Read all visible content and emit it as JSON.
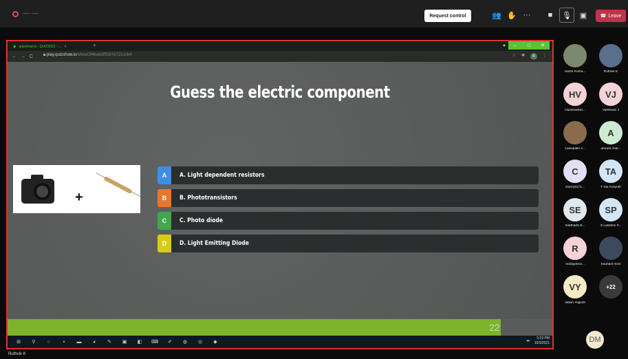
{
  "colors": {
    "answer_a": "#3d8fe6",
    "answer_b": "#e8772e",
    "answer_c": "#3ea84b",
    "answer_d": "#d9cc16",
    "leave": "#c4314b",
    "share_border": "#e0312e",
    "progress": "#7db32a"
  },
  "topbar": {
    "request_control": "Request control",
    "leave_label": "Leave",
    "more_label": "···"
  },
  "browser": {
    "tab_title": "quizshow.io - QUIZ0021 - ...",
    "url_domain": "play.quizshow.io",
    "url_path": "/show/2f4bab3f5587e7231cb4",
    "profile_initial": "R"
  },
  "quiz": {
    "question": "Guess the electric component",
    "answers": [
      {
        "letter": "A",
        "text": "A. Light dependent resistors"
      },
      {
        "letter": "B",
        "text": "B. Phototransistors"
      },
      {
        "letter": "C",
        "text": "C. Photo diode"
      },
      {
        "letter": "D",
        "text": "D. Light Emitting Diode"
      }
    ],
    "image_plus": "+",
    "progress_fraction": 0.905,
    "progress_count": "22"
  },
  "taskbar": {
    "time": "5:03 PM",
    "date": "10/3/2021"
  },
  "presenter_name": "Ruthvik K",
  "participants": [
    {
      "name": "Harsh Kuma...",
      "initials": "",
      "bg": "#7b8a6e",
      "photo": true
    },
    {
      "name": "Ruthvik K",
      "initials": "",
      "bg": "#5a6f8c",
      "photo": true
    },
    {
      "name": "Harishankar...",
      "initials": "HV",
      "bg": "#f4d2d6",
      "photo": false
    },
    {
      "name": "Vaishnavi J",
      "initials": "VJ",
      "bg": "#f4d2d6",
      "photo": false
    },
    {
      "name": "Lankipalle J...",
      "initials": "",
      "bg": "#8a6b4e",
      "photo": true
    },
    {
      "name": "amruth.char...",
      "initials": "A",
      "bg": "#cdebd3",
      "photo": false
    },
    {
      "name": "cherryb171...",
      "initials": "C",
      "bg": "#e2def3",
      "photo": false
    },
    {
      "name": "T Sai Achyuth",
      "initials": "TA",
      "bg": "#d3e6f6",
      "photo": false
    },
    {
      "name": "Siddharth E...",
      "initials": "SE",
      "bg": "#dfe8ee",
      "photo": false
    },
    {
      "name": "S Lakshmi P...",
      "initials": "SP",
      "bg": "#d3e6f6",
      "photo": false
    },
    {
      "name": "reddyjahna...",
      "initials": "R",
      "bg": "#f4d2d6",
      "photo": false
    },
    {
      "name": "Sauhard Soni",
      "initials": "",
      "bg": "#3c4a5e",
      "photo": true
    },
    {
      "name": "Valluri Yogesh",
      "initials": "VY",
      "bg": "#f8e9c6",
      "photo": false
    },
    {
      "name": "",
      "initials": "+22",
      "bg": "#3a3a3a",
      "photo": false
    }
  ],
  "self_initials": "DM"
}
